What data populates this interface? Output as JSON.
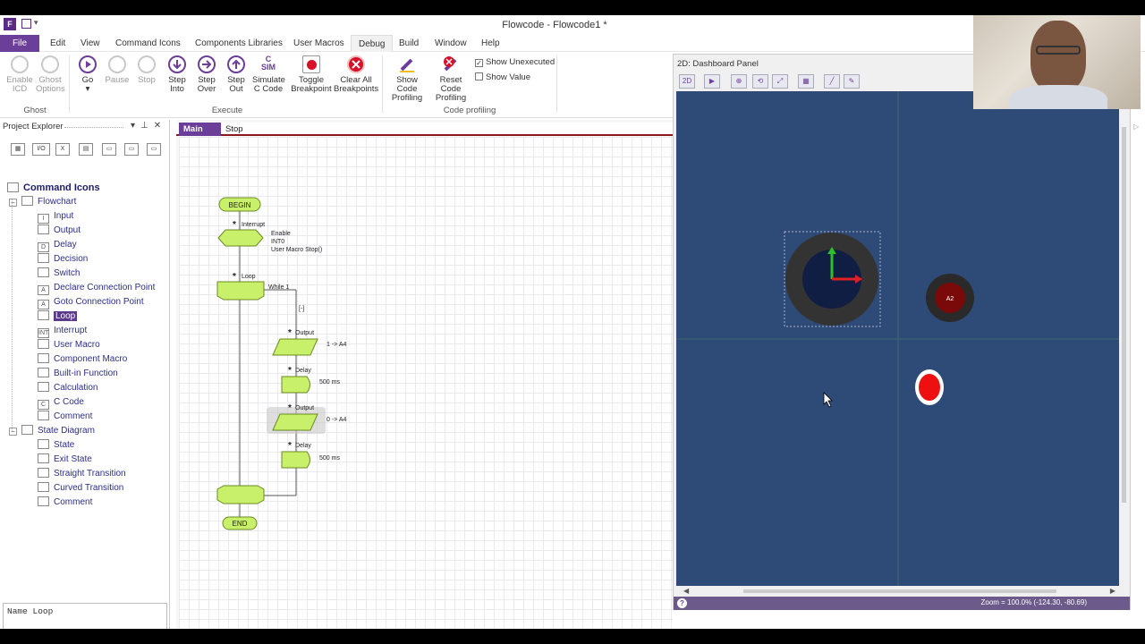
{
  "window": {
    "title": "Flowcode - Flowcode1 *"
  },
  "menu": [
    "File",
    "Edit",
    "View",
    "Command Icons",
    "Components Libraries",
    "User Macros",
    "Debug",
    "Build",
    "Window",
    "Help"
  ],
  "ribbon": {
    "ghost": {
      "enable_icd": [
        "Enable",
        "ICD"
      ],
      "ghost_options": [
        "Ghost",
        "Options"
      ],
      "label": "Ghost"
    },
    "execute": {
      "go": "Go",
      "pause": "Pause",
      "stop": "Stop",
      "step_into": [
        "Step",
        "Into"
      ],
      "step_over": [
        "Step",
        "Over"
      ],
      "step_out": [
        "Step",
        "Out"
      ],
      "simulate": [
        "Simulate",
        "C Code"
      ],
      "sim_icon_text": [
        "C",
        "SIM"
      ],
      "toggle_bp": [
        "Toggle",
        "Breakpoint"
      ],
      "clear_bp": [
        "Clear All",
        "Breakpoints"
      ],
      "label": "Execute"
    },
    "profiling": {
      "show": [
        "Show Code",
        "Profiling"
      ],
      "reset": [
        "Reset Code",
        "Profiling"
      ],
      "show_unexecuted": "Show Unexecuted",
      "show_unexecuted_checked": true,
      "show_value": "Show Value",
      "show_value_checked": false,
      "label": "Code profiling"
    }
  },
  "project_explorer": {
    "title": "Project Explorer",
    "toolbar_icons": [
      "grid-icon",
      "io-icon",
      "x-icon",
      "component-icon",
      "panel-icon",
      "panel-icon",
      "panel-icon"
    ],
    "io_label": "I/O",
    "x_label": "X",
    "root": "Command Icons",
    "flowchart": "Flowchart",
    "flowchart_items": [
      "Input",
      "Output",
      "Delay",
      "Decision",
      "Switch",
      "Declare Connection Point",
      "Goto Connection Point",
      "Loop",
      "Interrupt",
      "User Macro",
      "Component Macro",
      "Built-in Function",
      "Calculation",
      "C Code",
      "Comment"
    ],
    "flowchart_icon_letters": [
      "I",
      "",
      "D",
      "",
      "",
      "A",
      "A",
      "",
      "INT",
      "",
      "",
      "",
      "",
      "C",
      ""
    ],
    "selected": "Loop",
    "state_diagram": "State Diagram",
    "state_items": [
      "State",
      "Exit State",
      "Straight Transition",
      "Curved Transition",
      "Comment"
    ],
    "property": "Name Loop"
  },
  "doc_tabs": [
    "Main",
    "Stop"
  ],
  "flowchart": {
    "begin": "BEGIN",
    "interrupt_title": "Interrupt",
    "interrupt_lines": [
      "Enable",
      "INT0",
      "User Macro Stop()"
    ],
    "loop_title": "Loop",
    "loop_cond": "While 1",
    "collapse": "[-]",
    "output1_title": "Output",
    "output1_text": "1 -> A4",
    "delay1_title": "Delay",
    "delay1_text": "500 ms",
    "output2_title": "Output",
    "output2_text": "0 -> A4",
    "delay2_title": "Delay",
    "delay2_text": "500 ms",
    "end": "END"
  },
  "dashboard": {
    "title": "2D: Dashboard Panel",
    "tool_icons": [
      "2d-icon",
      "pointer-icon",
      "fit-icon",
      "rotate-icon",
      "expand-icon",
      "grid-icon",
      "wrench-icon",
      "pen-icon"
    ],
    "tool_text_2d": "2D",
    "led_label": "A2",
    "zoom": "Zoom = 100.0% (-124.30, -80.69)",
    "help": "?"
  },
  "colors": {
    "accent": "#6b3e9a",
    "flow_fill": "#c8f06a",
    "flow_stroke": "#6a8a20",
    "dashboard_bg": "#2e4a77"
  }
}
